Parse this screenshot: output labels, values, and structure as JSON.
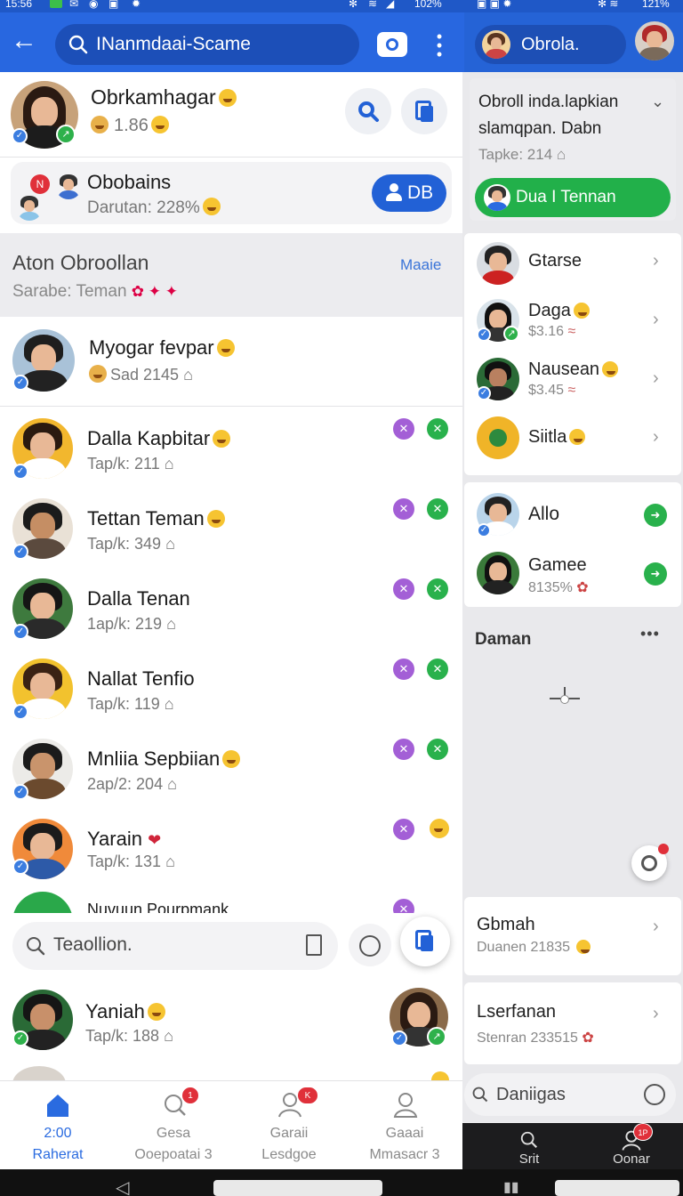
{
  "status": {
    "time": "15:56",
    "battery_left": "102%",
    "battery_right": "121%"
  },
  "header": {
    "search_text": "INanmdaai‐Scame",
    "right_title": "Obrola."
  },
  "profile": {
    "name": "Obrkamhagar",
    "sub": "1.86"
  },
  "promo": {
    "title": "Obobains",
    "sub": "Darutan: 228%",
    "button": "DB"
  },
  "section": {
    "title": "Aton Obroollan",
    "more": "Maaie",
    "sub": "Sarabe: Teman"
  },
  "featured": {
    "name": "Myogar fevpar",
    "sub": "Sad 2145"
  },
  "contacts": [
    {
      "name": "Dalla Kapbitar",
      "sub": "Tap/k: 211"
    },
    {
      "name": "Tettan Teman",
      "sub": "Tap/k: 349"
    },
    {
      "name": "Dalla Tenan",
      "sub": "1ap/k: 219"
    },
    {
      "name": "Nallat Tenfio",
      "sub": "Tap/k: 119"
    },
    {
      "name": "Mnliia Sepbiian",
      "sub": "2ap/2: 204"
    },
    {
      "name": "Yarain",
      "sub": "Tap/k: 131"
    }
  ],
  "partial_contact": "Nuvuun Pourpmank",
  "search_bar": {
    "placeholder": "Teaollion."
  },
  "last_contact": {
    "name": "Yaniah",
    "sub": "Tap/k: 188"
  },
  "bottom_nav": [
    {
      "label1": "2:00",
      "label2": "Raherat"
    },
    {
      "label1": "Gesa",
      "label2": "Ooepoatai 3",
      "badge": "1"
    },
    {
      "label1": "Garaii",
      "label2": "Lesdgoe",
      "badge": "K"
    },
    {
      "label1": "Gaaai",
      "label2": "Mmasacr 3"
    }
  ],
  "right": {
    "group_card": {
      "line1": "Obroll inda.lapkian",
      "line2": "slamqpan. Dabn",
      "sub": "Tapke: 214",
      "button": "Dua I Tennan"
    },
    "list": [
      {
        "name": "Gtarse",
        "sub": ""
      },
      {
        "name": "Daga",
        "sub": "$3.16"
      },
      {
        "name": "Nausean",
        "sub": "$3.45"
      },
      {
        "name": "Siitla",
        "sub": ""
      }
    ],
    "list2": [
      {
        "name": "Allo",
        "sub": ""
      },
      {
        "name": "Gamee",
        "sub": "8135%"
      }
    ],
    "daman": {
      "title": "Daman",
      "more": "•••"
    },
    "item1": {
      "name": "Gbmah",
      "sub": "Duanen 21835"
    },
    "item2": {
      "name": "Lserfanan",
      "sub": "Stenran 233515"
    },
    "search": {
      "placeholder": "Daniigas"
    },
    "nav": [
      {
        "label": "Srit"
      },
      {
        "label": "Oonar",
        "badge": "1P"
      }
    ]
  }
}
